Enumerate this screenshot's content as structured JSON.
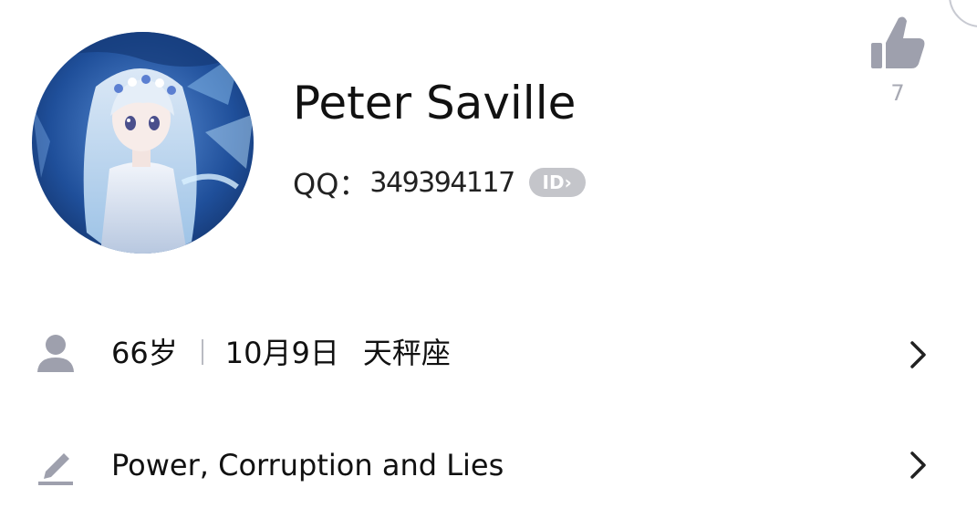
{
  "profile": {
    "name": "Peter Saville",
    "qq_label": "QQ：",
    "qq_number": "349394117",
    "id_badge": "ID›",
    "avatar_icon": "avatar"
  },
  "like": {
    "icon": "thumbs-up-icon",
    "count": "7"
  },
  "info_rows": [
    {
      "icon": "person-icon",
      "age": "66岁",
      "birthday": "10月9日",
      "zodiac": "天秤座"
    },
    {
      "icon": "pencil-icon",
      "signature": "Power, Corruption and Lies"
    }
  ],
  "colors": {
    "icon_gray": "#9ea0ad",
    "text": "#111111",
    "badge": "#c4c5ca"
  }
}
